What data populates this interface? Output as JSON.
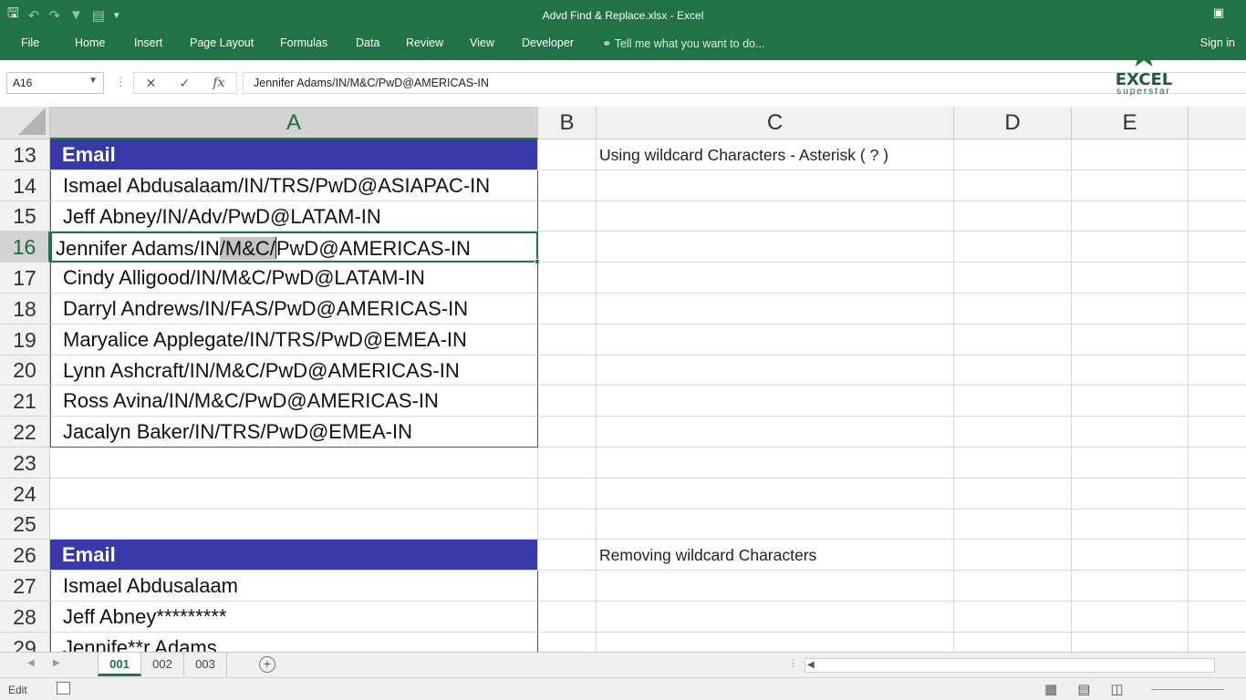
{
  "window": {
    "title": "Advd Find & Replace.xlsx - Excel",
    "qat_icons": [
      "save-icon",
      "undo-icon",
      "redo-icon",
      "filter-icon",
      "print-preview-icon",
      "customize-icon"
    ]
  },
  "ribbon": {
    "tabs": [
      "File",
      "Home",
      "Insert",
      "Page Layout",
      "Formulas",
      "Data",
      "Review",
      "View",
      "Developer"
    ],
    "tell_me": "Tell me what you want to do...",
    "sign_in": "Sign in"
  },
  "formula_bar": {
    "name_box": "A16",
    "cancel": "✕",
    "enter": "✓",
    "fx": "fx",
    "content": "Jennifer Adams/IN/M&C/PwD@AMERICAS-IN"
  },
  "logo": {
    "line1": "EXCEL",
    "line2": "superstar"
  },
  "grid": {
    "columns": [
      "A",
      "B",
      "C",
      "D",
      "E"
    ],
    "rows": [
      {
        "n": "13",
        "a": "Email",
        "c": "Using wildcard Characters - Asterisk ( ? )"
      },
      {
        "n": "14",
        "a": "Ismael Abdusalaam/IN/TRS/PwD@ASIAPAC-IN",
        "c": ""
      },
      {
        "n": "15",
        "a": "Jeff Abney/IN/Adv/PwD@LATAM-IN",
        "c": ""
      },
      {
        "n": "16",
        "a": "",
        "c": ""
      },
      {
        "n": "17",
        "a": "Cindy Alligood/IN/M&C/PwD@LATAM-IN",
        "c": ""
      },
      {
        "n": "18",
        "a": "Darryl Andrews/IN/FAS/PwD@AMERICAS-IN",
        "c": ""
      },
      {
        "n": "19",
        "a": "Maryalice Applegate/IN/TRS/PwD@EMEA-IN",
        "c": ""
      },
      {
        "n": "20",
        "a": "Lynn Ashcraft/IN/M&C/PwD@AMERICAS-IN",
        "c": ""
      },
      {
        "n": "21",
        "a": "Ross Avina/IN/M&C/PwD@AMERICAS-IN",
        "c": ""
      },
      {
        "n": "22",
        "a": "Jacalyn Baker/IN/TRS/PwD@EMEA-IN",
        "c": ""
      },
      {
        "n": "23",
        "a": "",
        "c": ""
      },
      {
        "n": "24",
        "a": "",
        "c": ""
      },
      {
        "n": "25",
        "a": "",
        "c": ""
      },
      {
        "n": "26",
        "a": "Email",
        "c": "Removing wildcard Characters"
      },
      {
        "n": "27",
        "a": "Ismael Abdusalaam",
        "c": ""
      },
      {
        "n": "28",
        "a": "Jeff Abney*********",
        "c": ""
      },
      {
        "n": "29",
        "a": "Jennife**r Adams",
        "c": ""
      }
    ],
    "editing_cell": {
      "before": "Jennifer Adams/IN",
      "selected": "/M&C/",
      "after": "PwD@AMERICAS-IN"
    }
  },
  "sheets": {
    "tabs": [
      "001",
      "002",
      "003"
    ],
    "active": "001"
  },
  "status": {
    "mode": "Edit"
  }
}
